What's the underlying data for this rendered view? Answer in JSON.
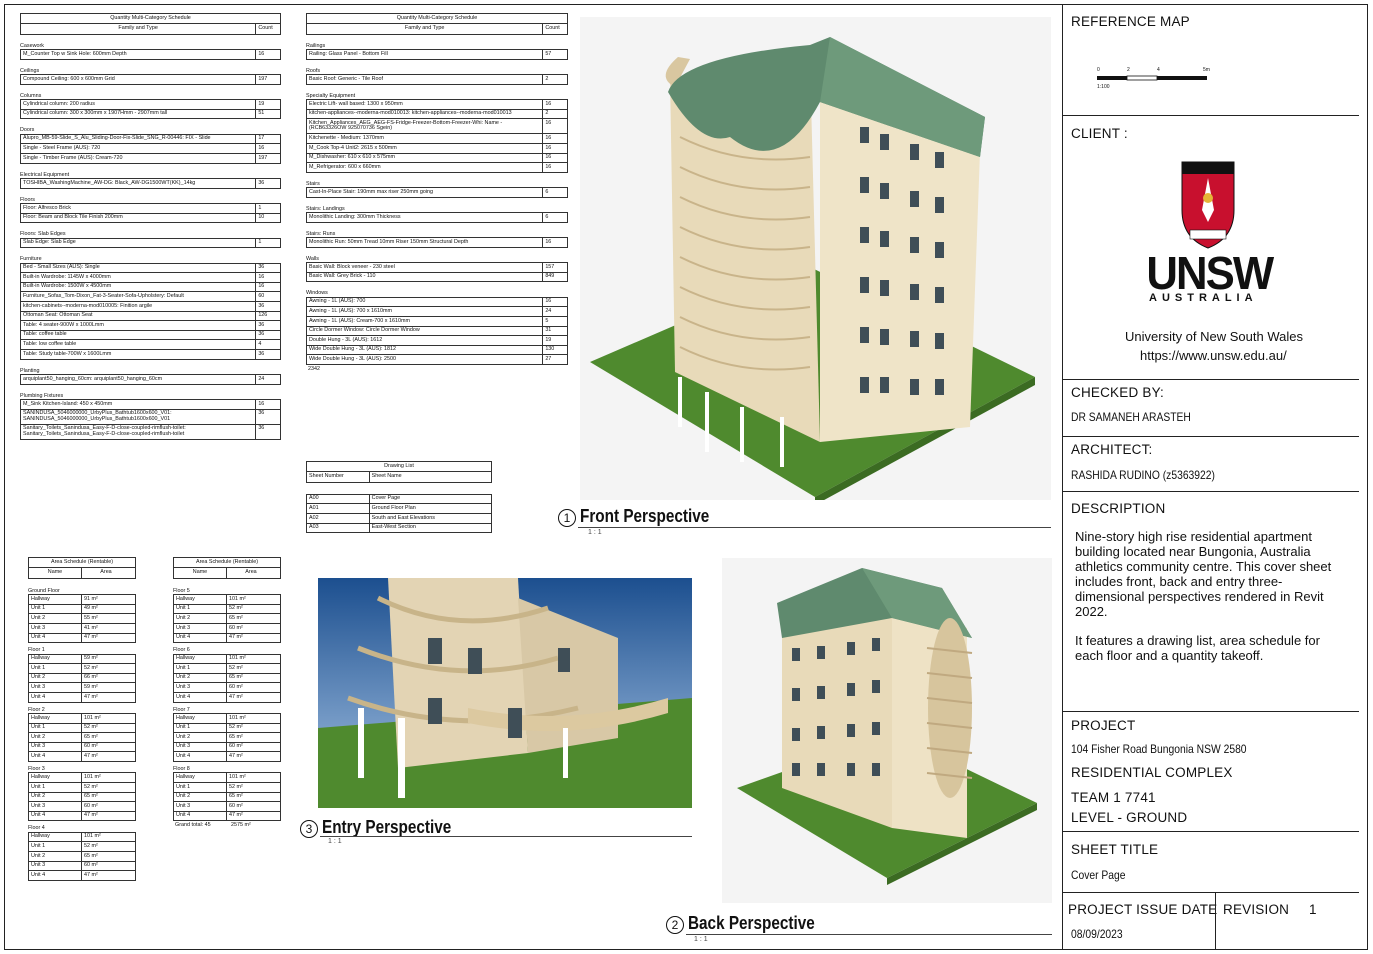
{
  "sheet": {
    "ref_map_label": "REFERENCE MAP",
    "scale_ticks": [
      "0",
      "2",
      "4",
      "5m"
    ],
    "scale_text": "1:100",
    "client_label": "CLIENT :",
    "logo_text": "UNSW",
    "logo_sub": "AUSTRALIA",
    "client_name": "University of New South Wales",
    "client_url": "https://www.unsw.edu.au/",
    "checked_label": "CHECKED BY:",
    "checked_by": "DR SAMANEH ARASTEH",
    "architect_label": "ARCHITECT:",
    "architect": "RASHIDA RUDINO (z5363922)",
    "description_label": "DESCRIPTION",
    "description_1": "Nine-story high rise residential apartment building located near Bungonia, Australia athletics community centre. This cover sheet includes front, back and entry three-dimensional perspectives rendered in Revit 2022.",
    "description_2": "It features a drawing list, area schedule for each floor and a quantity takeoff.",
    "project_label": "PROJECT",
    "project_address": "104 Fisher Road Bungonia NSW 2580",
    "project_name": "RESIDENTIAL COMPLEX",
    "team": "TEAM 1 7741",
    "level": "LEVEL - GROUND",
    "sheet_title_label": "SHEET TITLE",
    "sheet_title": "Cover Page",
    "issue_label": "PROJECT ISSUE DATE",
    "issue_date": "08/09/2023",
    "revision_label": "REVISION",
    "revision": "1"
  },
  "views": {
    "front": {
      "num": "1",
      "name": "Front Perspective",
      "scale": "1 : 1"
    },
    "back": {
      "num": "2",
      "name": "Back Perspective",
      "scale": "1 : 1"
    },
    "entry": {
      "num": "3",
      "name": "Entry Perspective",
      "scale": "1 : 1"
    }
  },
  "qty1": {
    "title": "Quantity Multi-Category Schedule",
    "col_family": "Family and Type",
    "col_count": "Count",
    "groups": [
      {
        "name": "Casework",
        "rows": [
          [
            "M_Counter Top w Sink Hole: 600mm Depth",
            "16"
          ]
        ]
      },
      {
        "name": "Ceilings",
        "rows": [
          [
            "Compound Ceiling: 600 x 600mm Grid",
            "197"
          ]
        ]
      },
      {
        "name": "Columns",
        "rows": [
          [
            "Cylindrical column: 200 radius",
            "19"
          ],
          [
            "Cylindrical column: 300 x 300mm x 1907Hmm - 2907mm tall",
            "51"
          ]
        ]
      },
      {
        "name": "Doors",
        "rows": [
          [
            "Alupro_MB-59-Slide_S_Alu_Sliding-Door-Fix-Slide_SNG_R-00446: FIX - Slide",
            "17"
          ],
          [
            "Single - Steel Frame (AUS): 720",
            "16"
          ],
          [
            "Single - Timber Frame (AUS): Cream-720",
            "197"
          ]
        ]
      },
      {
        "name": "Electrical Equipment",
        "rows": [
          [
            "TOSHIBA_WashingMachine_AW-DG: Black_AW-DG1500WT(KK)_14kg",
            "36"
          ]
        ]
      },
      {
        "name": "Floors",
        "rows": [
          [
            "Floor: Alfresco Brick",
            "1"
          ],
          [
            "Floor: Beam and Block Tile Finish 200mm",
            "10"
          ]
        ]
      },
      {
        "name": "Floors: Slab Edges",
        "rows": [
          [
            "Slab Edge: Slab Edge",
            "1"
          ]
        ]
      },
      {
        "name": "Furniture",
        "rows": [
          [
            "Bed - Small Sizes (AUS): Single",
            "36"
          ],
          [
            "Built-in Wardrobe: 1145W x 4000mm",
            "16"
          ],
          [
            "Built-in Wardrobe: 1500W x 4500mm",
            "16"
          ],
          [
            "Furniture_Sofas_Tom-Dixon_Fat-3-Seater-Sofa-Upholstery: Default",
            "60"
          ],
          [
            "kitchen-cabinets--moderna-mod010005: Finition argile",
            "36"
          ],
          [
            "Ottoman Seat: Ottoman Seat",
            "126"
          ],
          [
            "Table: 4 seater-900W x 1000Lmm",
            "36"
          ],
          [
            "Table: coffee table",
            "36"
          ],
          [
            "Table: low coffee table",
            "4"
          ],
          [
            "Table: Study table-700W x 1600Lmm",
            "36"
          ]
        ]
      },
      {
        "name": "Planting",
        "rows": [
          [
            "arquiplant50_hanging_60cm: arquiplant50_hanging_60cm",
            "24"
          ]
        ]
      },
      {
        "name": "Plumbing Fixtures",
        "rows": [
          [
            "M_Sink Kitchen-Island: 450 x 450mm",
            "16"
          ],
          [
            "SANINDUSA_5046000000_UrbyPlus_Bathtub1600x600_V01: SANINDUSA_5046000000_UrbyPlus_Bathtub1600x600_V01",
            "36"
          ],
          [
            "Sanitary_Toilets_Sanindusa_Easy-F-D-close-coupled-rimflush-toilet: Sanitary_Toilets_Sanindusa_Easy-F-D-close-coupled-rimflush-toilet",
            "36"
          ]
        ]
      }
    ]
  },
  "qty2": {
    "title": "Quantity Multi-Category Schedule",
    "col_family": "Family and Type",
    "col_count": "Count",
    "groups": [
      {
        "name": "Railings",
        "rows": [
          [
            "Railing: Glass Panel - Bottom Fill",
            "57"
          ]
        ]
      },
      {
        "name": "Roofs",
        "rows": [
          [
            "Basic Roof: Generic - Tile Roof",
            "2"
          ]
        ]
      },
      {
        "name": "Specialty Equipment",
        "rows": [
          [
            "Electric Lift- wall based: 1300 x 950mm",
            "16"
          ],
          [
            "kitchen-appliances--moderna-mod010013: kitchen-appliances--moderna-mod010013",
            "2"
          ],
          [
            "Kitchen_Appliances_AEG_AEG-FS-Fridge-Freezer-Bottom-Freezer-Whi: Name - (RCB63326OW 925070736 Sgein)",
            "16"
          ],
          [
            "Kitchenette - Medium: 1370mm",
            "16"
          ],
          [
            "M_Cook Top-4 Unit2: 2615 x 500mm",
            "16"
          ],
          [
            "M_Dishwasher: 610 x 610 x 575mm",
            "16"
          ],
          [
            "M_Refrigerator: 600 x 660mm",
            "16"
          ]
        ]
      },
      {
        "name": "Stairs",
        "rows": [
          [
            "Cast-In-Place Stair: 190mm max riser 250mm going",
            "6"
          ]
        ]
      },
      {
        "name": "Stairs: Landings",
        "rows": [
          [
            "Monolithic Landing: 300mm Thickness",
            "6"
          ]
        ]
      },
      {
        "name": "Stairs: Runs",
        "rows": [
          [
            "Monolithic Run: 50mm Tread 10mm Riser 150mm Structural Depth",
            "16"
          ]
        ]
      },
      {
        "name": "Walls",
        "rows": [
          [
            "Basic Wall: Block veneer - 230 steel",
            "157"
          ],
          [
            "Basic Wall: Grey Brick - 110",
            "849"
          ]
        ]
      },
      {
        "name": "Windows",
        "rows": [
          [
            "Awning - 1L (AUS): 700",
            "16"
          ],
          [
            "Awning - 1L (AUS): 700 x 1610mm",
            "24"
          ],
          [
            "Awning - 1L (AUS): Cream-700 x 1610mm",
            "5"
          ],
          [
            "Circle Dormer Window: Circle Dormer Window",
            "31"
          ],
          [
            "Double Hung - 3L (AUS): 1612",
            "19"
          ],
          [
            "Wide Double Hung - 3L (AUS): 1812",
            "130"
          ],
          [
            "Wide Double Hung - 3L (AUS): 2500",
            "27"
          ]
        ]
      }
    ],
    "total": "2342"
  },
  "drawing_list": {
    "title": "Drawing List",
    "col_num": "Sheet Number",
    "col_name": "Sheet Name",
    "rows": [
      [
        "A00",
        "Cover Page"
      ],
      [
        "A01",
        "Ground Floor Plan"
      ],
      [
        "A02",
        "South and East Elevations"
      ],
      [
        "A03",
        "East-West Section"
      ]
    ]
  },
  "area1": {
    "title": "Area Schedule (Rentable)",
    "col_name": "Name",
    "col_area": "Area",
    "levels": [
      {
        "name": "Ground Floor",
        "rows": [
          [
            "Hallway",
            "91 m²"
          ],
          [
            "Unit 1",
            "49 m²"
          ],
          [
            "Unit 2",
            "55 m²"
          ],
          [
            "Unit 3",
            "41 m²"
          ],
          [
            "Unit 4",
            "47 m²"
          ]
        ]
      },
      {
        "name": "Floor 1",
        "rows": [
          [
            "Hallway",
            "59 m²"
          ],
          [
            "Unit 1",
            "52 m²"
          ],
          [
            "Unit 2",
            "66 m²"
          ],
          [
            "Unit 3",
            "59 m²"
          ],
          [
            "Unit 4",
            "47 m²"
          ]
        ]
      },
      {
        "name": "Floor 2",
        "rows": [
          [
            "Hallway",
            "101 m²"
          ],
          [
            "Unit 1",
            "52 m²"
          ],
          [
            "Unit 2",
            "65 m²"
          ],
          [
            "Unit 3",
            "60 m²"
          ],
          [
            "Unit 4",
            "47 m²"
          ]
        ]
      },
      {
        "name": "Floor 3",
        "rows": [
          [
            "Hallway",
            "101 m²"
          ],
          [
            "Unit 1",
            "52 m²"
          ],
          [
            "Unit 2",
            "65 m²"
          ],
          [
            "Unit 3",
            "60 m²"
          ],
          [
            "Unit 4",
            "47 m²"
          ]
        ]
      },
      {
        "name": "Floor 4",
        "rows": [
          [
            "Hallway",
            "101 m²"
          ],
          [
            "Unit 1",
            "52 m²"
          ],
          [
            "Unit 2",
            "65 m²"
          ],
          [
            "Unit 3",
            "60 m²"
          ],
          [
            "Unit 4",
            "47 m²"
          ]
        ]
      }
    ]
  },
  "area2": {
    "title": "Area Schedule (Rentable)",
    "col_name": "Name",
    "col_area": "Area",
    "levels": [
      {
        "name": "Floor 5",
        "rows": [
          [
            "Hallway",
            "101 m²"
          ],
          [
            "Unit 1",
            "52 m²"
          ],
          [
            "Unit 2",
            "65 m²"
          ],
          [
            "Unit 3",
            "60 m²"
          ],
          [
            "Unit 4",
            "47 m²"
          ]
        ]
      },
      {
        "name": "Floor 6",
        "rows": [
          [
            "Hallway",
            "101 m²"
          ],
          [
            "Unit 1",
            "52 m²"
          ],
          [
            "Unit 2",
            "65 m²"
          ],
          [
            "Unit 3",
            "60 m²"
          ],
          [
            "Unit 4",
            "47 m²"
          ]
        ]
      },
      {
        "name": "Floor 7",
        "rows": [
          [
            "Hallway",
            "101 m²"
          ],
          [
            "Unit 1",
            "52 m²"
          ],
          [
            "Unit 2",
            "65 m²"
          ],
          [
            "Unit 3",
            "60 m²"
          ],
          [
            "Unit 4",
            "47 m²"
          ]
        ]
      },
      {
        "name": "Floor 8",
        "rows": [
          [
            "Hallway",
            "101 m²"
          ],
          [
            "Unit 1",
            "52 m²"
          ],
          [
            "Unit 2",
            "65 m²"
          ],
          [
            "Unit 3",
            "60 m²"
          ],
          [
            "Unit 4",
            "47 m²"
          ]
        ]
      }
    ],
    "total_label": "Grand total: 45",
    "total_value": "2575 m²"
  },
  "colors": {
    "roof": "#5f8a6e",
    "wall": "#e9dcc0",
    "grass": "#4f8a2e",
    "logo_red": "#c8102e"
  }
}
